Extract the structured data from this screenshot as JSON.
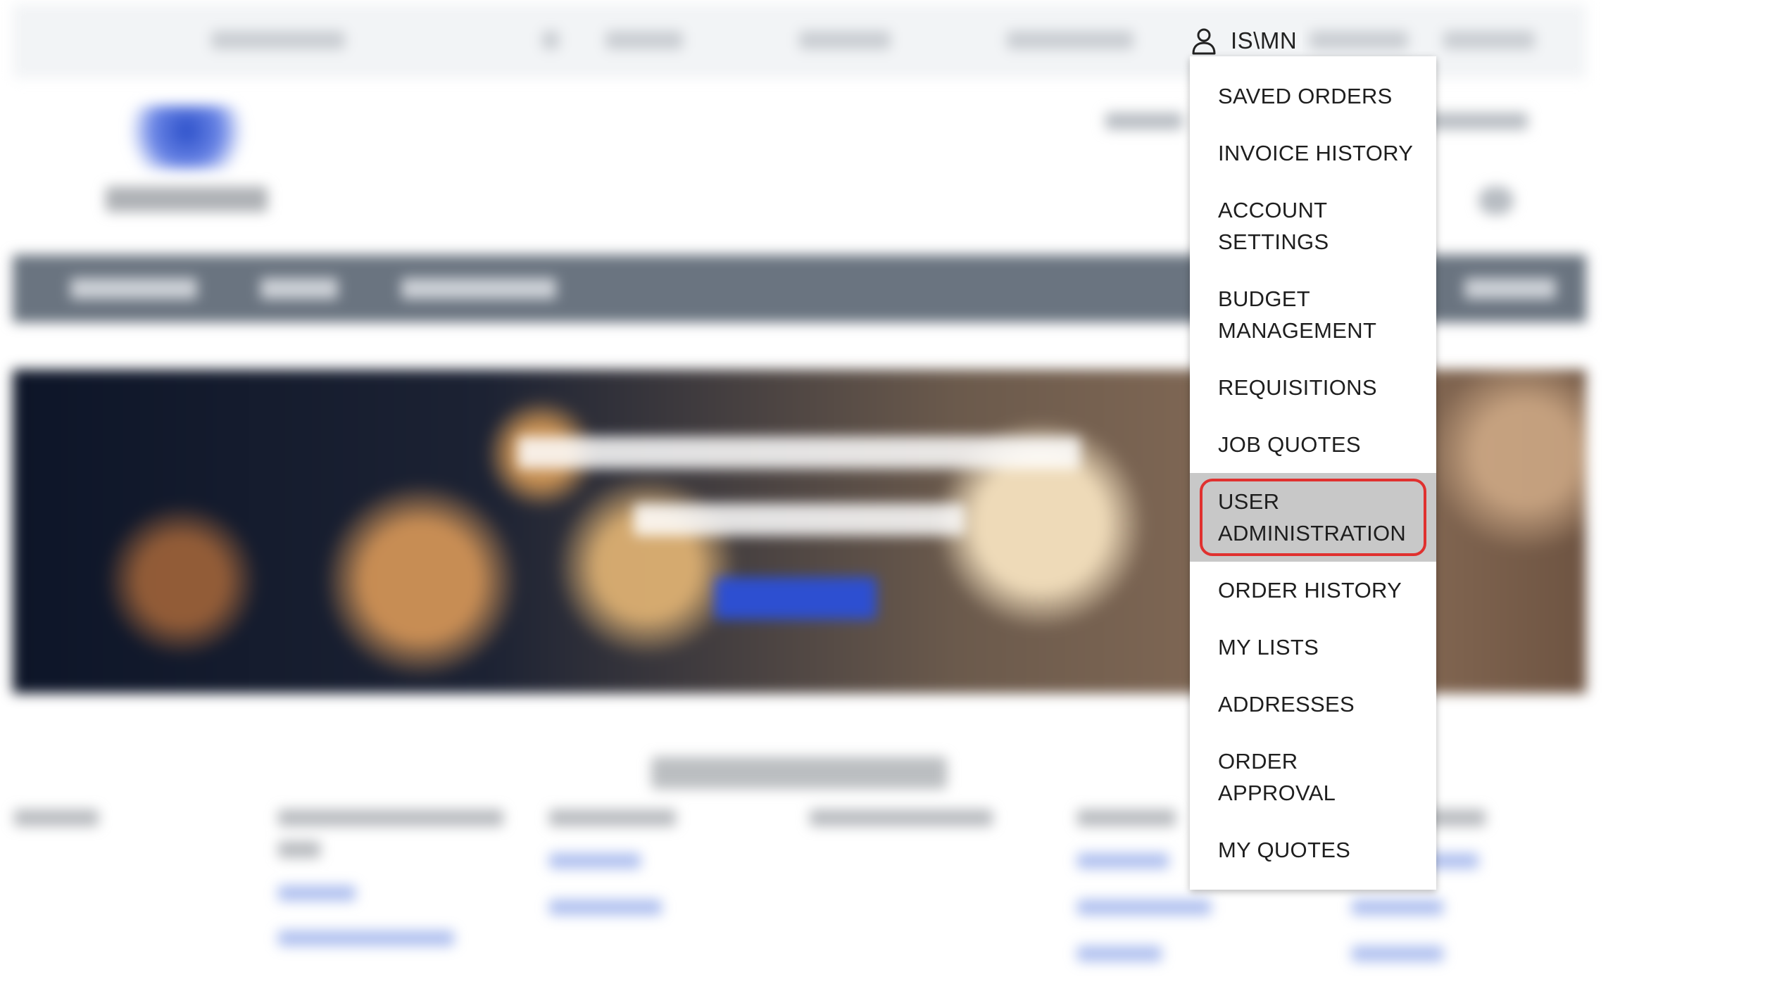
{
  "user": {
    "name": "IS\\MN",
    "icon": "user-icon"
  },
  "account_menu": {
    "items": [
      {
        "label": "SAVED ORDERS"
      },
      {
        "label": "INVOICE HISTORY"
      },
      {
        "label": "ACCOUNT SETTINGS"
      },
      {
        "label": "BUDGET MANAGEMENT"
      },
      {
        "label": "REQUISITIONS"
      },
      {
        "label": "JOB QUOTES"
      },
      {
        "label": "USER ADMINISTRATION",
        "highlighted": true
      },
      {
        "label": "ORDER HISTORY"
      },
      {
        "label": "MY LISTS"
      },
      {
        "label": "ADDRESSES"
      },
      {
        "label": "ORDER APPROVAL"
      },
      {
        "label": "MY QUOTES"
      }
    ]
  },
  "colors": {
    "highlight_ring": "#e0312f",
    "active_item_bg": "#c8c8c8",
    "nav_bar": "#6a7480",
    "hero_button": "#2d4fd1"
  }
}
